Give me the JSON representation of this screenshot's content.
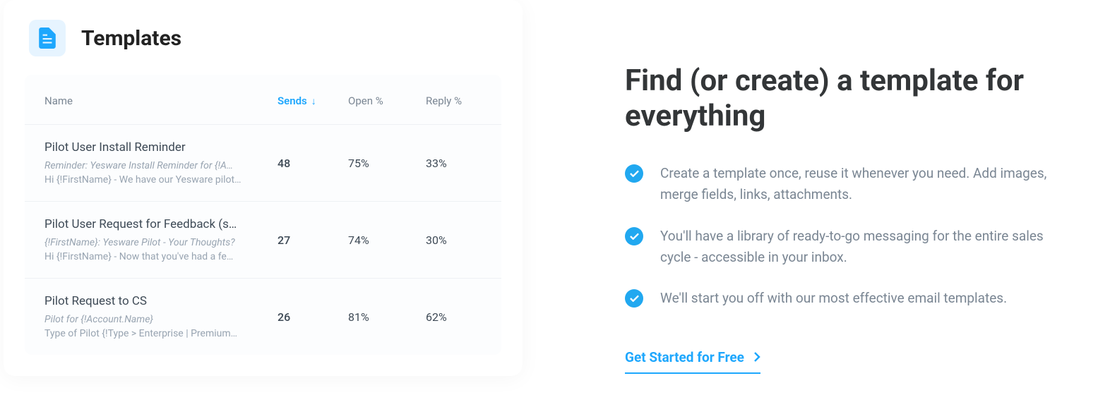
{
  "card": {
    "title": "Templates",
    "columns": {
      "name": "Name",
      "sends": "Sends",
      "open": "Open %",
      "reply": "Reply %"
    },
    "rows": [
      {
        "title": "Pilot User Install Reminder",
        "subject": "Reminder: Yesware Install Reminder for {!A…",
        "body": "Hi {!FirstName} - We have our Yesware pilot…",
        "sends": "48",
        "open": "75%",
        "reply": "33%"
      },
      {
        "title": "Pilot User Request for Feedback (s…",
        "subject": "{!FirstName}: Yesware Pilot - Your Thoughts?",
        "body": "Hi {!FirstName} - Now that you've had a fe…",
        "sends": "27",
        "open": "74%",
        "reply": "30%"
      },
      {
        "title": "Pilot Request to CS",
        "subject": "Pilot for {!Account.Name}",
        "body": "Type of Pilot {!Type > Enterprise | Premium…",
        "sends": "26",
        "open": "81%",
        "reply": "62%"
      }
    ]
  },
  "hero": {
    "headline": "Find (or create) a template for everything",
    "features": [
      "Create a template once, reuse it whenever you need. Add images, merge fields, links, attachments.",
      "You'll have a library of ready-to-go messaging for the entire sales cycle - accessible in your inbox.",
      "We'll start you off with our most effective email templates."
    ],
    "cta": "Get Started for Free"
  }
}
